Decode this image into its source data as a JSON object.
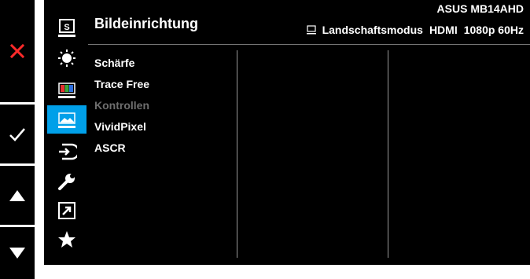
{
  "osd": {
    "title": "Bildeinrichtung",
    "model": "ASUS MB14AHD",
    "status": {
      "mode": "Landschaftsmodus",
      "input": "HDMI",
      "resolution": "1080p 60Hz"
    },
    "sidebar_icons": [
      {
        "name": "splendid-icon",
        "label": "S"
      },
      {
        "name": "blue-light-filter-icon"
      },
      {
        "name": "color-icon"
      },
      {
        "name": "image-icon",
        "selected": true
      },
      {
        "name": "input-select-icon"
      },
      {
        "name": "system-setup-icon"
      },
      {
        "name": "shortcut-icon"
      },
      {
        "name": "myfavorite-icon"
      }
    ],
    "menu_items": [
      {
        "label": "Schärfe",
        "enabled": true
      },
      {
        "label": "Trace Free",
        "enabled": true
      },
      {
        "label": "Kontrollen",
        "enabled": false
      },
      {
        "label": "VividPixel",
        "enabled": true
      },
      {
        "label": "ASCR",
        "enabled": true
      }
    ]
  },
  "keys": [
    {
      "name": "close-icon"
    },
    {
      "name": "checkmark-icon"
    },
    {
      "name": "up-arrow-icon"
    },
    {
      "name": "down-arrow-icon"
    }
  ],
  "colors": {
    "accent": "#00a0e9",
    "close": "#ff2a2a",
    "disabled_text": "#6e6e6e"
  }
}
